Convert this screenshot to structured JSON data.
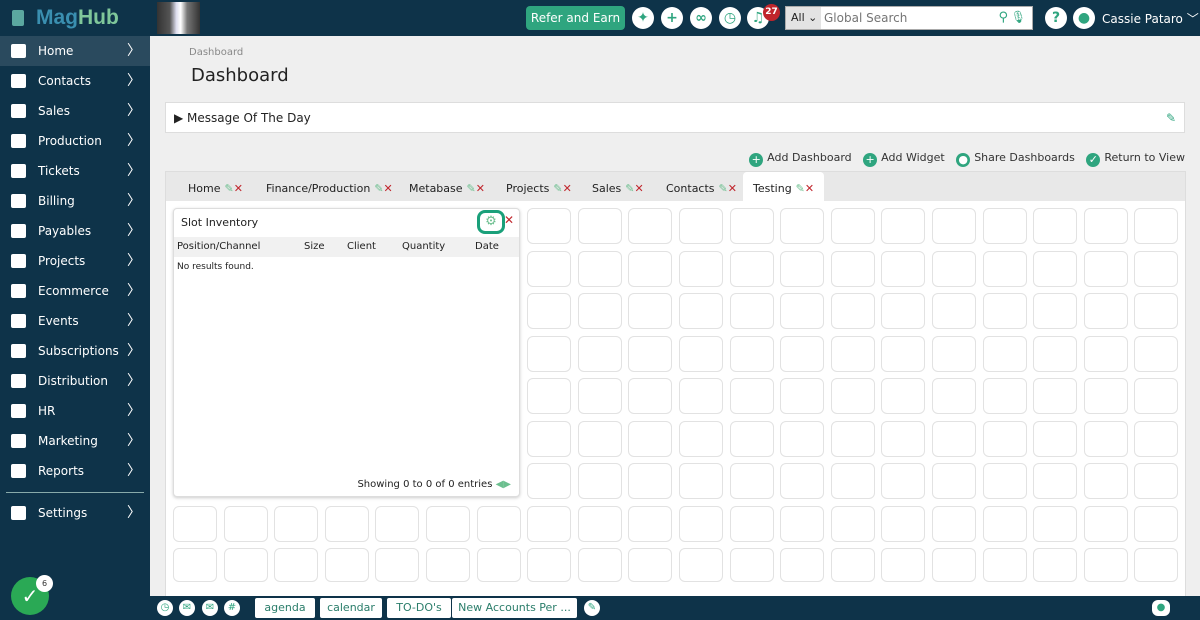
{
  "header": {
    "logo_mag": "Mag",
    "logo_hub": "Hub",
    "refer_label": "Refer and Earn",
    "notifications_count": "27",
    "search_scope": "All",
    "search_placeholder": "Global Search",
    "user_name": "Cassie Pataro",
    "accent": "#2fa57f"
  },
  "sidebar": {
    "items": [
      {
        "label": "Home",
        "active": true
      },
      {
        "label": "Contacts"
      },
      {
        "label": "Sales"
      },
      {
        "label": "Production"
      },
      {
        "label": "Tickets"
      },
      {
        "label": "Billing"
      },
      {
        "label": "Payables"
      },
      {
        "label": "Projects"
      },
      {
        "label": "Ecommerce"
      },
      {
        "label": "Events"
      },
      {
        "label": "Subscriptions"
      },
      {
        "label": "Distribution"
      },
      {
        "label": "HR"
      },
      {
        "label": "Marketing"
      },
      {
        "label": "Reports"
      }
    ],
    "settings": "Settings",
    "task_count": "6"
  },
  "page": {
    "breadcrumb": "Dashboard",
    "title": "Dashboard",
    "motd": "Message Of The Day"
  },
  "actions": {
    "add_dashboard": "Add Dashboard",
    "add_widget": "Add Widget",
    "share": "Share Dashboards",
    "return": "Return to View"
  },
  "tabs": [
    "Home",
    "Finance/Production",
    "Metabase",
    "Projects",
    "Sales",
    "Contacts",
    "Testing"
  ],
  "active_tab": "Testing",
  "widget": {
    "title": "Slot Inventory",
    "columns": [
      "Position/Channel",
      "Size",
      "Client",
      "Quantity",
      "Date"
    ],
    "empty": "No results found.",
    "footer": "Showing 0 to 0 of 0 entries"
  },
  "bottombar": {
    "tabs": [
      "agenda",
      "calendar",
      "TO-DO's",
      "New Accounts Per ..."
    ]
  }
}
